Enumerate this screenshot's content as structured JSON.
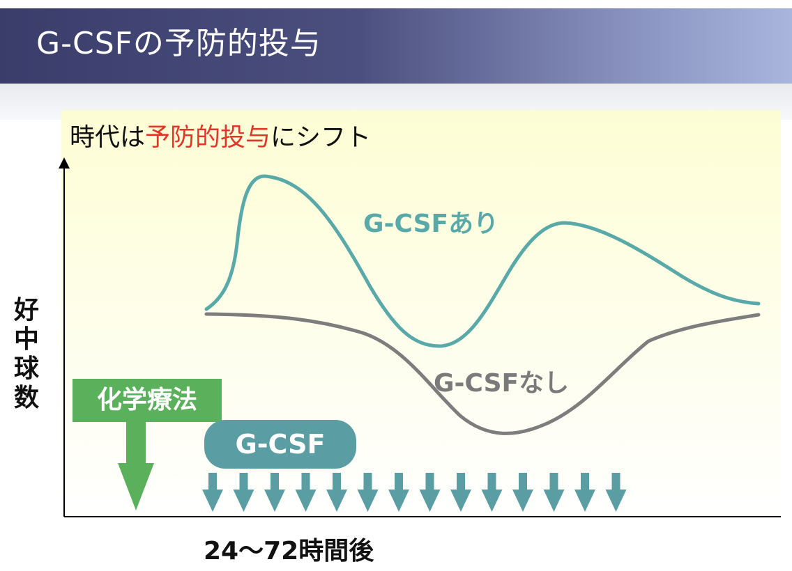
{
  "title": "G-CSFの予防的投与",
  "subtitle": {
    "prefix": "時代は",
    "highlight": "予防的投与",
    "suffix": "にシフト"
  },
  "y_axis_label": [
    "好",
    "中",
    "球",
    "数"
  ],
  "x_axis_label": "24〜72時間後",
  "curves": {
    "with_gcsf": "G-CSFあり",
    "without_gcsf": "G-CSFなし"
  },
  "chemo_label": "化学療法",
  "gcsf_label": "G-CSF",
  "gcsf_arrow_count": 14,
  "colors": {
    "title_bar_start": "#3a3d6a",
    "title_bar_end": "#a9b5dd",
    "highlight_red": "#e2362b",
    "curve_with": "#5aa9a9",
    "curve_without": "#7a7a7a",
    "chemo_green": "#5bb05c",
    "gcsf_teal": "#5a9ea3"
  }
}
